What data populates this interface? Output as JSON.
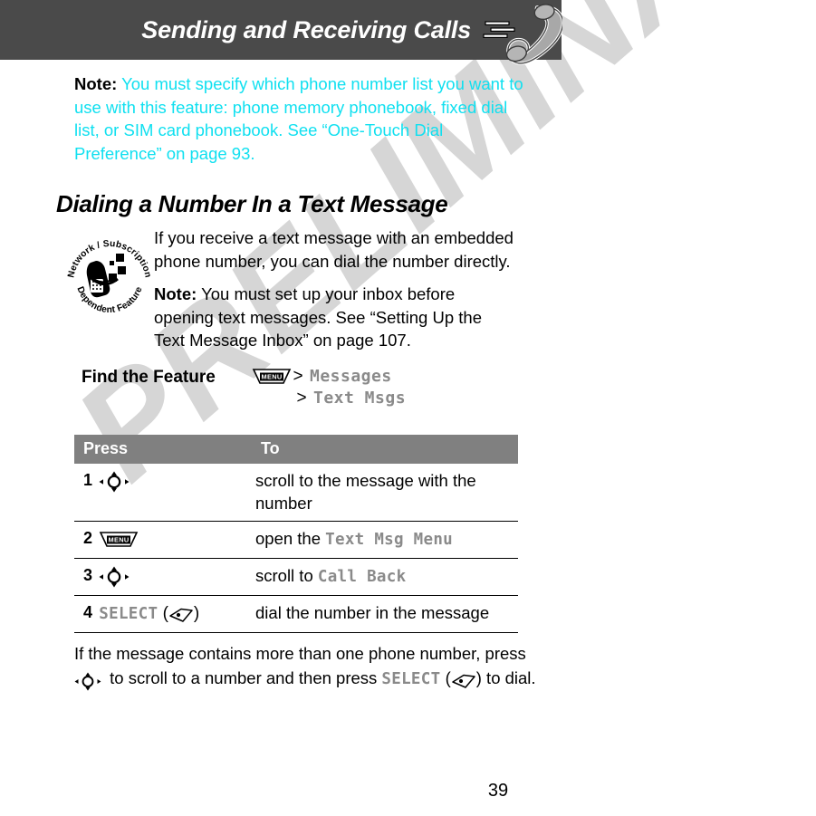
{
  "header": {
    "title": "Sending and Receiving Calls",
    "icon": "phone-handset-icon"
  },
  "watermark": {
    "text": "PRELIMINARY",
    "color": "#d6d6d6"
  },
  "colors": {
    "header_bar": "#4a4a4a",
    "table_header": "#808080",
    "note_cyan": "#10E0F0",
    "mono_gray": "#8a8a8a"
  },
  "top_note": {
    "label": "Note:",
    "text": " You must specify which phone number list you want to use with this feature: phone memory phonebook, fixed dial list, or SIM card phonebook. See “One-Touch Dial Preference” on page 93."
  },
  "section": {
    "heading": "Dialing a Number In a Text Message",
    "badge_icon": "network-subscription-dependent-feature-badge",
    "badge_text_top": "Network / Subscription",
    "badge_text_bottom": "Dependent Feature",
    "paragraph_1": "If you receive a text message with an embedded phone number, you can dial the number directly.",
    "paragraph_2_label": "Note:",
    "paragraph_2": " You must set up your inbox before opening text messages. See “Setting Up the Text Message Inbox” on page 107."
  },
  "find_feature": {
    "label": "Find the Feature",
    "menu_key_label": "MENU",
    "separator": ">",
    "path": [
      "Messages",
      "Text Msgs"
    ]
  },
  "table": {
    "headers": {
      "press": "Press",
      "to": "To"
    },
    "rows": [
      {
        "num": "1",
        "key_icon": "navigation-key-icon",
        "key_label": "",
        "to_prefix": "scroll to the message with the number",
        "to_mono": "",
        "to_suffix": ""
      },
      {
        "num": "2",
        "key_icon": "menu-key-icon",
        "key_label": "MENU",
        "to_prefix": "open the ",
        "to_mono": "Text Msg Menu",
        "to_suffix": ""
      },
      {
        "num": "3",
        "key_icon": "navigation-key-icon",
        "key_label": "",
        "to_prefix": "scroll to ",
        "to_mono": "Call Back",
        "to_suffix": ""
      },
      {
        "num": "4",
        "key_icon": "soft-key-icon",
        "key_label": "SELECT",
        "to_prefix": "dial the number in the message",
        "to_mono": "",
        "to_suffix": ""
      }
    ]
  },
  "trailing": {
    "part_1": "If the message contains more than one phone number, press ",
    "part_2": " to scroll to a number and then press ",
    "part_3_mono": "SELECT",
    "part_4": " (",
    "part_5": ") to dial."
  },
  "page_number": "39"
}
